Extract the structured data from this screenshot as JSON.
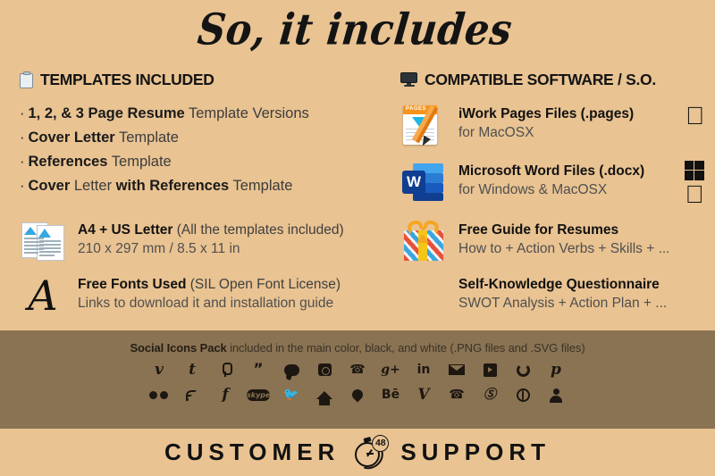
{
  "title": "So, it includes",
  "colors": {
    "background": "#e9c392",
    "band": "#8a7353",
    "text": "#1a1a1a"
  },
  "left": {
    "heading": "TEMPLATES INCLUDED",
    "heading_icon": "clipboard-icon",
    "bullets": [
      {
        "bold": "1, 2, & 3 Page Resume",
        "rest": " Template Versions"
      },
      {
        "bold": "Cover Letter",
        "rest": " Template"
      },
      {
        "bold": "References",
        "rest": " Template"
      },
      {
        "bold": "Cover",
        "rest": " Letter ",
        "bold2": "with References",
        "rest2": " Template"
      }
    ],
    "features": [
      {
        "icon": "documents-icon",
        "line1_bold": "A4 + US Letter",
        "line1_rest": " (All the templates included)",
        "line2": "210 x 297 mm / 8.5 x 11 in"
      },
      {
        "icon": "letter-a-icon",
        "line1_bold": "Free Fonts Used",
        "line1_rest": " (SIL Open Font License)",
        "line2": "Links to download it and installation guide"
      }
    ]
  },
  "right": {
    "heading": "COMPATIBLE SOFTWARE / S.O.",
    "heading_icon": "monitor-icon",
    "features": [
      {
        "icon": "pages-app-icon",
        "line1": "iWork Pages Files (.pages)",
        "line2": "for MacOSX",
        "platforms": [
          "apple-icon"
        ]
      },
      {
        "icon": "word-app-icon",
        "line1": "Microsoft Word Files (.docx)",
        "line2": "for Windows & MacOSX",
        "platforms": [
          "windows-icon",
          "apple-icon"
        ]
      },
      {
        "icon": "gift-icon",
        "line1": "Free Guide for Resumes",
        "line2": "How to + Action Verbs + Skills + ...",
        "platforms": []
      },
      {
        "icon": "none",
        "line1": "Self-Knowledge Questionnaire",
        "line2": "SWOT Analysis + Action Plan + ...",
        "platforms": []
      }
    ]
  },
  "band": {
    "caption_bold": "Social Icons Pack",
    "caption_rest": " included in the main color, black, and white (.PNG files and .SVG files)",
    "row1": [
      {
        "name": "vimeo-icon",
        "glyph": "v",
        "style": "serif"
      },
      {
        "name": "tumblr-icon",
        "glyph": "t",
        "style": "serif"
      },
      {
        "name": "podcast-icon",
        "glyph": "",
        "style": "shape-podcast"
      },
      {
        "name": "quote-icon",
        "glyph": "”",
        "style": "plain"
      },
      {
        "name": "chat-icon",
        "glyph": "",
        "style": "shape-chat"
      },
      {
        "name": "instagram-icon",
        "glyph": "",
        "style": "shape-insta"
      },
      {
        "name": "viber-icon",
        "glyph": "✆",
        "style": "plain"
      },
      {
        "name": "google-plus-icon",
        "glyph": "g+",
        "style": "sm"
      },
      {
        "name": "linkedin-icon",
        "glyph": "in",
        "style": "sm"
      },
      {
        "name": "email-icon",
        "glyph": "",
        "style": "shape-mail"
      },
      {
        "name": "youtube-icon",
        "glyph": "",
        "style": "shape-yt"
      },
      {
        "name": "refresh-icon",
        "glyph": "",
        "style": "shape-ring"
      },
      {
        "name": "pinterest-icon",
        "glyph": "p",
        "style": "serif"
      }
    ],
    "row2": [
      {
        "name": "flickr-icon",
        "glyph": "",
        "style": "shape-flickr"
      },
      {
        "name": "rss-icon",
        "glyph": "",
        "style": "shape-rss"
      },
      {
        "name": "facebook-icon",
        "glyph": "f",
        "style": "serif"
      },
      {
        "name": "skype-icon",
        "glyph": "skype",
        "style": "shape-skype"
      },
      {
        "name": "twitter-icon",
        "glyph": "ᴠ",
        "style": "shape-twitter"
      },
      {
        "name": "home-icon",
        "glyph": "",
        "style": "shape-home"
      },
      {
        "name": "location-pin-icon",
        "glyph": "",
        "style": "shape-pin"
      },
      {
        "name": "behance-icon",
        "glyph": "Bē",
        "style": "sm"
      },
      {
        "name": "vine-icon",
        "glyph": "V",
        "style": "serif"
      },
      {
        "name": "whatsapp-icon",
        "glyph": "✆",
        "style": "shape-wa"
      },
      {
        "name": "wordpress-icon",
        "glyph": "W",
        "style": "shape-wp"
      },
      {
        "name": "globe-icon",
        "glyph": "",
        "style": "shape-globe"
      },
      {
        "name": "person-icon",
        "glyph": "",
        "style": "shape-person"
      }
    ]
  },
  "footer": {
    "left_word": "CUSTOMER",
    "right_word": "SUPPORT",
    "badge": "48",
    "icon": "stopwatch-icon"
  }
}
